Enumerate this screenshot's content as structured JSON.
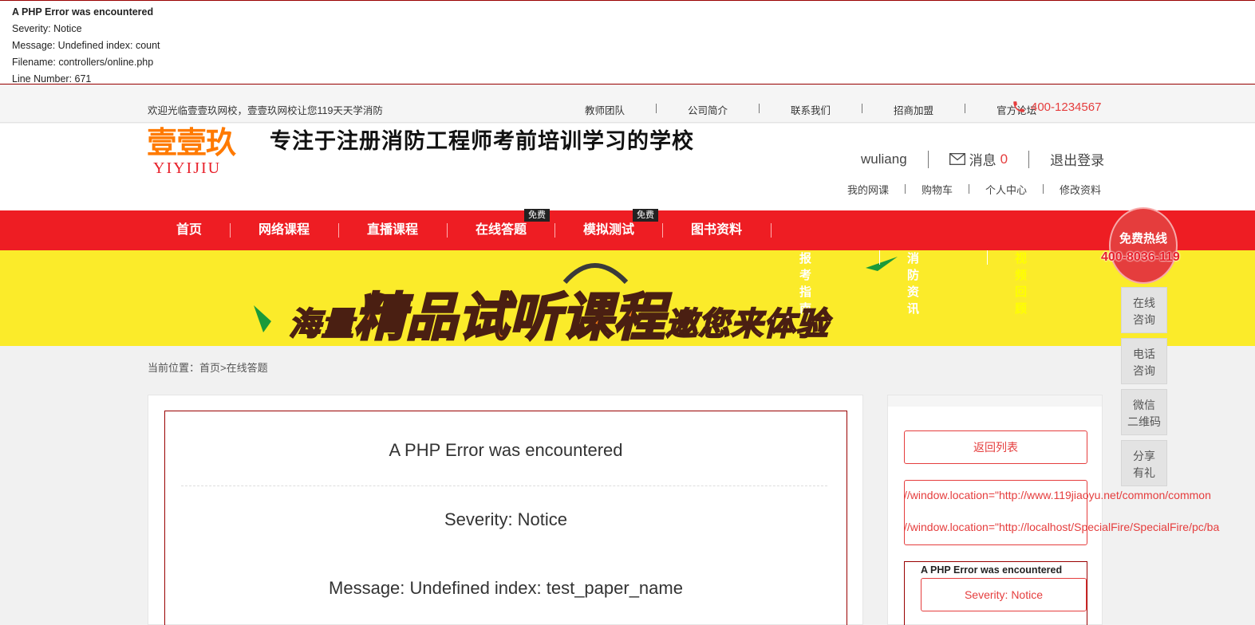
{
  "php_error_top": {
    "title": "A PHP Error was encountered",
    "severity": "Severity: Notice",
    "message": "Message: Undefined index: count",
    "filename": "Filename: controllers/online.php",
    "line": "Line Number: 671"
  },
  "topbar": {
    "welcome": "欢迎光临壹壹玖网校，壹壹玖网校让您119天天学消防",
    "links": [
      "教师团队",
      "公司简介",
      "联系我们",
      "招商加盟",
      "官方论坛"
    ],
    "phone": "400-1234567"
  },
  "header": {
    "logo_cn": "壹壹玖",
    "logo_en": "YIYIJIU",
    "slogan": "专注于注册消防工程师考前培训学习的学校",
    "username": "wuliang",
    "messages_label": "消息",
    "messages_count": "0",
    "logout": "退出登录",
    "user_links": [
      "我的网课",
      "购物车",
      "个人中心",
      "修改资料"
    ]
  },
  "nav": {
    "items": [
      "首页",
      "网络课程",
      "直播课程",
      "在线答题",
      "模拟测试",
      "图书资料"
    ],
    "badge": "免费",
    "sub_items": [
      "报考指南",
      "消防资讯",
      "视频回顾"
    ]
  },
  "banner": {
    "pre": "海量",
    "big": "精品试听课程",
    "post": "邀您来体验"
  },
  "breadcrumb": "当前位置：首页>在线答题",
  "main": {
    "err_title": "A PHP Error was encountered",
    "err_severity": "Severity: Notice",
    "err_message": "Message: Undefined index: test_paper_name"
  },
  "side": {
    "back_label": "返回列表",
    "code_line_1": "//window.location=\"http://www.119jiaoyu.net/common/common",
    "code_line_2": "//window.location=\"http://localhost/SpecialFire/SpecialFire/pc/ba",
    "err_title": "A PHP Error was encountered",
    "err_severity": "Severity: Notice"
  },
  "float": {
    "free_call": "免费热线",
    "hotline": "400-8036-119",
    "buttons": [
      {
        "line1": "在线",
        "line2": "咨询"
      },
      {
        "line1": "电话",
        "line2": "咨询"
      },
      {
        "line1": "微信",
        "line2": "二维码"
      },
      {
        "line1": "分享",
        "line2": "有礼"
      }
    ]
  },
  "colors": {
    "brand_red": "#ee1d23",
    "accent_red": "#e53d3d",
    "banner_yellow": "#fbeb2a",
    "logo_orange": "#ff7a00"
  }
}
